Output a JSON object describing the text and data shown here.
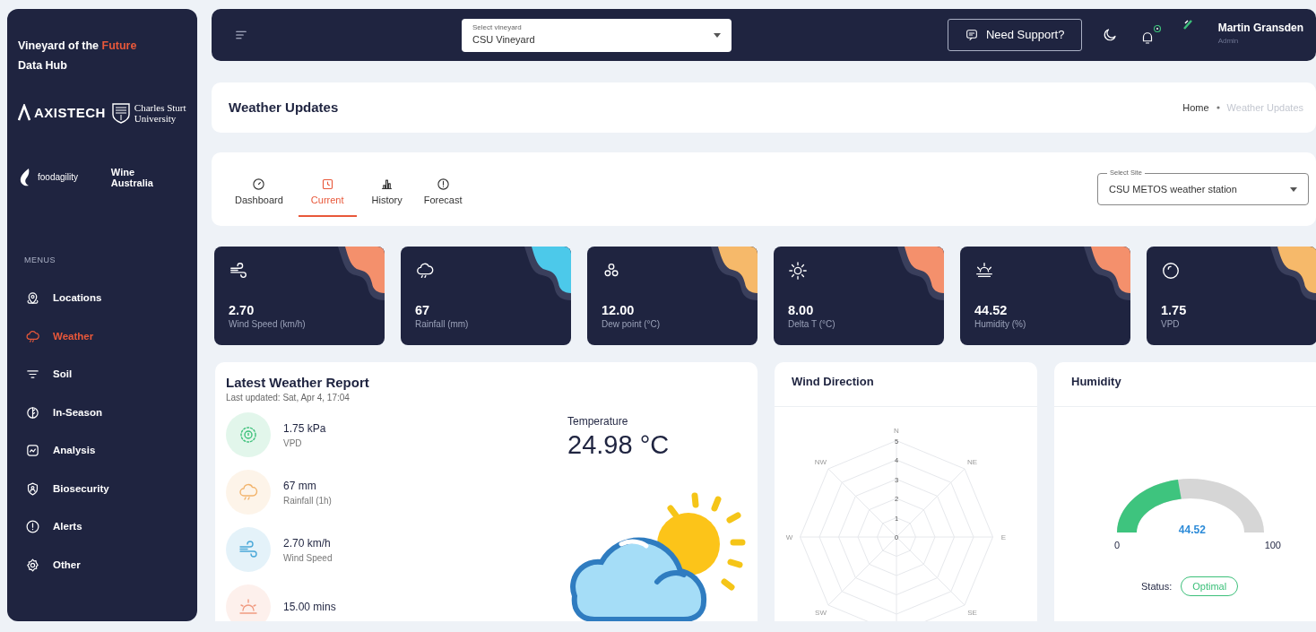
{
  "sidebar": {
    "brand_parts": [
      {
        "text": "Vineyard of the ",
        "accent": false
      },
      {
        "text": "Future",
        "accent": true
      }
    ],
    "subtitle": "Data Hub",
    "logos": [
      {
        "kind": "axistech",
        "text": "AXISTECH"
      },
      {
        "kind": "university",
        "text": "Charles Sturt University"
      },
      {
        "kind": "foodagility",
        "text": "foodagility"
      },
      {
        "kind": "plain",
        "text": "Wine Australia"
      }
    ],
    "menu_heading": "MENUS",
    "items": [
      {
        "label": "Locations",
        "kind": "pin",
        "selected": false
      },
      {
        "label": "Weather",
        "kind": "cloudrain",
        "selected": true
      },
      {
        "label": "Soil",
        "kind": "soil",
        "selected": false
      },
      {
        "label": "In-Season",
        "kind": "leaf",
        "selected": false
      },
      {
        "label": "Analysis",
        "kind": "chart",
        "selected": false
      },
      {
        "label": "Biosecurity",
        "kind": "shield",
        "selected": false
      },
      {
        "label": "Alerts",
        "kind": "alert",
        "selected": false
      },
      {
        "label": "Other",
        "kind": "gear",
        "selected": false
      }
    ]
  },
  "topbar": {
    "vineyard_select": {
      "label": "Select vineyard",
      "value": "CSU Vineyard"
    },
    "support_button": "Need Support?",
    "user": {
      "name": "Martin Gransden",
      "role": "Admin"
    }
  },
  "page_header": {
    "title": "Weather Updates",
    "breadcrumb": [
      {
        "label": "Home",
        "active": false
      },
      {
        "label": "Weather Updates",
        "active": true
      }
    ]
  },
  "tabs": [
    {
      "label": "Dashboard",
      "kind": "gauge",
      "selected": false
    },
    {
      "label": "Current",
      "kind": "clock",
      "selected": true
    },
    {
      "label": "History",
      "kind": "bars",
      "selected": false
    },
    {
      "label": "Forecast",
      "kind": "alert",
      "selected": false
    }
  ],
  "site_select": {
    "label": "Select Site",
    "value": "CSU METOS weather station"
  },
  "stats": [
    {
      "kind": "wind",
      "value": "2.70",
      "label": "Wind Speed (km/h)",
      "color": "#f4906c"
    },
    {
      "kind": "cloudrain",
      "value": "67",
      "label": "Rainfall (mm)",
      "color": "#4cc9ea"
    },
    {
      "kind": "drops",
      "value": "12.00",
      "label": "Dew point (°C)",
      "color": "#f6b96a"
    },
    {
      "kind": "sun",
      "value": "8.00",
      "label": "Delta T (°C)",
      "color": "#f4906c"
    },
    {
      "kind": "sunhaze",
      "value": "44.52",
      "label": "Humidity (%)",
      "color": "#f4906c"
    },
    {
      "kind": "dropcircle",
      "value": "1.75",
      "label": "VPD",
      "color": "#f6b96a"
    }
  ],
  "report": {
    "title": "Latest Weather Report",
    "updated": "Last updated: Sat, Apr 4, 17:04",
    "items": [
      {
        "kind": "target",
        "value": "1.75 kPa",
        "label": "VPD"
      },
      {
        "kind": "cloudrain",
        "value": "67 mm",
        "label": "Rainfall (1h)"
      },
      {
        "kind": "wind",
        "value": "2.70 km/h",
        "label": "Wind Speed"
      },
      {
        "kind": "sunset",
        "value": "15.00 mins"
      }
    ],
    "temperature": {
      "label": "Temperature",
      "value": "24.98 °C"
    }
  },
  "wind_direction": {
    "title": "Wind Direction",
    "directions": [
      "N",
      "NE",
      "E",
      "SE",
      "SW",
      "W",
      "NW"
    ],
    "ring_labels": [
      "5",
      "4",
      "3",
      "2",
      "1",
      "0"
    ]
  },
  "humidity": {
    "title": "Humidity",
    "level": 0.4452,
    "value": "44.52",
    "min": "0",
    "max": "100",
    "status_label": "Status:",
    "status": "Optimal"
  }
}
